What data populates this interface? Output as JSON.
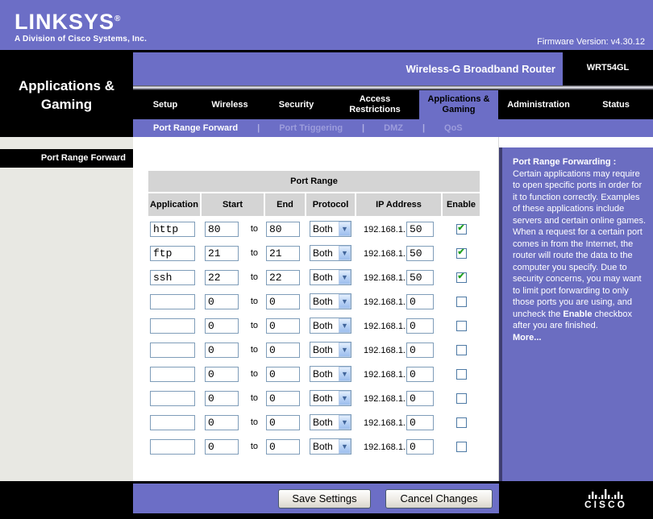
{
  "header": {
    "brand": "LINKSYS",
    "reg": "®",
    "tagline": "A Division of Cisco Systems, Inc.",
    "firmware": "Firmware Version: v4.30.12",
    "router_name": "Wireless-G Broadband Router",
    "model": "WRT54GL"
  },
  "page_title": "Applications & Gaming",
  "tabs": [
    {
      "id": "setup",
      "label": "Setup",
      "active": false
    },
    {
      "id": "wireless",
      "label": "Wireless",
      "active": false
    },
    {
      "id": "security",
      "label": "Security",
      "active": false
    },
    {
      "id": "access-restrictions",
      "label": "Access Restrictions",
      "active": false
    },
    {
      "id": "applications-gaming",
      "label": "Applications & Gaming",
      "active": true
    },
    {
      "id": "administration",
      "label": "Administration",
      "active": false
    },
    {
      "id": "status",
      "label": "Status",
      "active": false
    }
  ],
  "subnav": {
    "separator": "|",
    "items": [
      {
        "id": "port-range-forward",
        "label": "Port Range Forward",
        "active": true
      },
      {
        "id": "port-triggering",
        "label": "Port Triggering",
        "active": false
      },
      {
        "id": "dmz",
        "label": "DMZ",
        "active": false
      },
      {
        "id": "qos",
        "label": "QoS",
        "active": false
      }
    ]
  },
  "sidebar": {
    "section_label": "Port Range Forward"
  },
  "table": {
    "caption": "Port Range",
    "columns": [
      "Application",
      "Start",
      "End",
      "Protocol",
      "IP Address",
      "Enable"
    ],
    "to_label": "to",
    "ip_prefix": "192.168.1.",
    "rows": [
      {
        "application": "http",
        "start": "80",
        "end": "80",
        "protocol": "Both",
        "ip_last": "50",
        "enabled": true
      },
      {
        "application": "ftp",
        "start": "21",
        "end": "21",
        "protocol": "Both",
        "ip_last": "50",
        "enabled": true
      },
      {
        "application": "ssh",
        "start": "22",
        "end": "22",
        "protocol": "Both",
        "ip_last": "50",
        "enabled": true
      },
      {
        "application": "",
        "start": "0",
        "end": "0",
        "protocol": "Both",
        "ip_last": "0",
        "enabled": false
      },
      {
        "application": "",
        "start": "0",
        "end": "0",
        "protocol": "Both",
        "ip_last": "0",
        "enabled": false
      },
      {
        "application": "",
        "start": "0",
        "end": "0",
        "protocol": "Both",
        "ip_last": "0",
        "enabled": false
      },
      {
        "application": "",
        "start": "0",
        "end": "0",
        "protocol": "Both",
        "ip_last": "0",
        "enabled": false
      },
      {
        "application": "",
        "start": "0",
        "end": "0",
        "protocol": "Both",
        "ip_last": "0",
        "enabled": false
      },
      {
        "application": "",
        "start": "0",
        "end": "0",
        "protocol": "Both",
        "ip_last": "0",
        "enabled": false
      },
      {
        "application": "",
        "start": "0",
        "end": "0",
        "protocol": "Both",
        "ip_last": "0",
        "enabled": false
      }
    ]
  },
  "help": {
    "title": "Port Range Forwarding :",
    "body_1": "Certain applications may require to open specific ports in order for it to function correctly. Examples of these applications include servers and certain online games. When a request for a certain port comes in from the Internet, the router will route the data to the computer you specify. Due to security concerns, you may want to limit port forwarding to only those ports you are using, and uncheck the ",
    "bold_word": "Enable",
    "body_2": " checkbox after you are finished.",
    "more": "More..."
  },
  "footer": {
    "save": "Save Settings",
    "cancel": "Cancel Changes",
    "cisco": "CISCO"
  },
  "icons": {
    "dropdown_arrow": "▼",
    "check": "✔"
  },
  "colors": {
    "purple": "#6C6EC6",
    "help_purple": "#6B6DC1",
    "sidebar_grey": "#E8E8E3",
    "table_grey": "#D4D4D4",
    "input_border": "#7F9DB9",
    "check_green": "#21A121"
  }
}
